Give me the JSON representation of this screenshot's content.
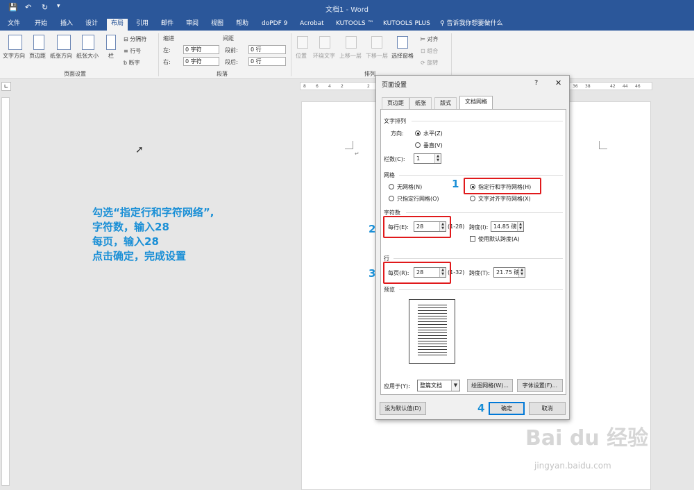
{
  "window": {
    "title": "文档1 - Word"
  },
  "tabs": [
    "文件",
    "开始",
    "插入",
    "设计",
    "布局",
    "引用",
    "邮件",
    "审阅",
    "视图",
    "帮助",
    "doPDF 9",
    "Acrobat",
    "KUTOOLS ™",
    "KUTOOLS PLUS"
  ],
  "active_tab": "布局",
  "tellme": "告诉我你想要做什么",
  "ribbon": {
    "page_setup": {
      "group_label": "页面设置",
      "text_direction": "文字方向",
      "margins": "页边距",
      "orientation": "纸张方向",
      "size": "纸张大小",
      "columns": "栏",
      "breaks": "分隔符",
      "line_numbers": "行号",
      "hyphenation": "断字"
    },
    "paragraph": {
      "group_label": "段落",
      "indent_label": "缩进",
      "spacing_label": "间距",
      "left_label": "左:",
      "left_value": "0 字符",
      "right_label": "右:",
      "right_value": "0 字符",
      "before_label": "段前:",
      "before_value": "0 行",
      "after_label": "段后:",
      "after_value": "0 行"
    },
    "arrange": {
      "group_label": "排列",
      "position": "位置",
      "wrap": "环绕文字",
      "forward": "上移一层",
      "backward": "下移一层",
      "selection_pane": "选择窗格",
      "align": "对齐",
      "group": "组合",
      "rotate": "旋转"
    }
  },
  "ruler": {
    "ticks": [
      "8",
      "6",
      "4",
      "2",
      "2",
      "36",
      "38",
      "42",
      "44",
      "46"
    ]
  },
  "annotation": {
    "lines": [
      "勾选“指定行和字符网络”,",
      "字符数，输入28",
      "每页，输入28",
      "点击确定，完成设置"
    ],
    "num1": "1",
    "num2": "2",
    "num3": "3",
    "num4": "4"
  },
  "dialog": {
    "title": "页面设置",
    "help": "?",
    "close": "✕",
    "tabs": [
      "页边距",
      "纸张",
      "版式",
      "文档网格"
    ],
    "active_tab": "文档网格",
    "text_arrangement": {
      "section": "文字排列",
      "direction_label": "方向:",
      "horizontal": "水平(Z)",
      "vertical": "垂直(V)",
      "columns_label": "栏数(C):",
      "columns_value": "1"
    },
    "grid": {
      "section": "网格",
      "no_grid": "无网格(N)",
      "line_grid_only": "只指定行网格(O)",
      "line_and_char_grid": "指定行和字符网格(H)",
      "snap_to_char": "文字对齐字符网格(X)"
    },
    "characters": {
      "section": "字符数",
      "per_line_label": "每行(E):",
      "per_line_value": "28",
      "per_line_range": "(1-28)",
      "pitch_label": "跨度(I):",
      "pitch_value": "14.85 磅",
      "use_default": "使用默认跨度(A)"
    },
    "lines": {
      "section": "行",
      "per_page_label": "每页(R):",
      "per_page_value": "28",
      "per_page_range": "(1-32)",
      "pitch_label": "跨度(T):",
      "pitch_value": "21.75 磅"
    },
    "preview": {
      "section": "预览"
    },
    "apply_to_label": "应用于(Y):",
    "apply_to_value": "整篇文档",
    "draw_grid": "绘图网格(W)...",
    "font_settings": "字体设置(F)...",
    "set_default": "设为默认值(D)",
    "ok": "确定",
    "cancel": "取消"
  },
  "watermark": {
    "brand": "Bai du 经验",
    "url": "jingyan.baidu.com"
  },
  "colors": {
    "word_blue": "#2b579a",
    "annotation_blue": "#1a8fd6",
    "highlight_red": "#e0191b"
  }
}
